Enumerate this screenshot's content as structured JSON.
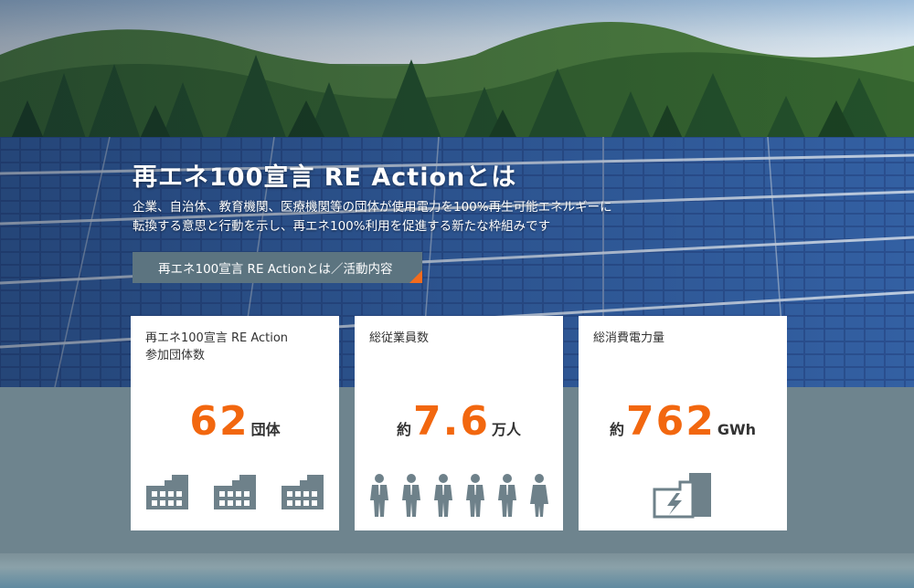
{
  "hero": {
    "title": "再エネ100宣言 RE Actionとは",
    "description_line1": "企業、自治体、教育機関、医療機関等の団体が使用電力を100%再生可能エネルギーに",
    "description_line2": "転換する意思と行動を示し、再エネ100%利用を促進する新たな枠組みです",
    "cta_label": "再エネ100宣言 RE Actionとは／活動内容"
  },
  "stats": [
    {
      "label_line1": "再エネ100宣言 RE Action",
      "label_line2": "参加団体数",
      "prefix": "",
      "value": "62",
      "unit": "団体",
      "icon": "building-icon"
    },
    {
      "label_line1": "総従業員数",
      "label_line2": "",
      "prefix": "約",
      "value": "7.6",
      "unit": "万人",
      "icon": "person-icon"
    },
    {
      "label_line1": "総消費電力量",
      "label_line2": "",
      "prefix": "約",
      "value": "762",
      "unit": "GWh",
      "icon": "power-plant-icon"
    }
  ],
  "colors": {
    "accent": "#f2670f",
    "button_bg": "#5c7480",
    "icon_gray": "#6e818a",
    "band_bg": "#6e848e"
  }
}
